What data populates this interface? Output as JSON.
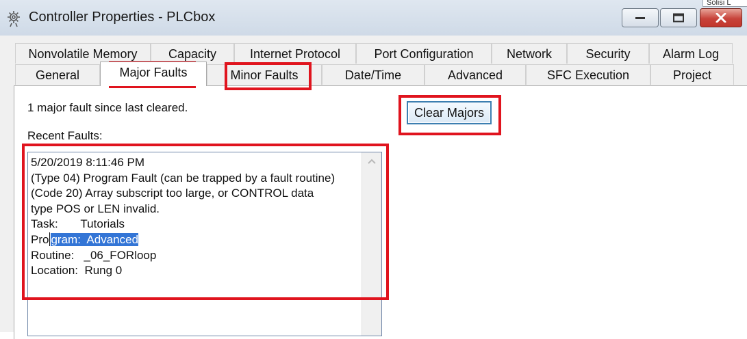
{
  "window": {
    "title": "Controller Properties - PLCbox",
    "icon": "gear-icon",
    "partial_label": "Solisi L"
  },
  "tabs_row1": [
    "Nonvolatile Memory",
    "Capacity",
    "Internet Protocol",
    "Port Configuration",
    "Network",
    "Security",
    "Alarm Log"
  ],
  "tabs_row2": [
    "General",
    "Major Faults",
    "Minor Faults",
    "Date/Time",
    "Advanced",
    "SFC Execution",
    "Project"
  ],
  "active_tab": "Major Faults",
  "major_faults": {
    "summary": "1 major fault since last cleared.",
    "recent_label": "Recent Faults:",
    "clear_button": "Clear Majors",
    "fault_lines": [
      "5/20/2019 8:11:46 PM",
      "(Type 04) Program Fault (can be trapped by a fault routine)",
      "(Code 20) Array subscript too large, or CONTROL data",
      "type POS or LEN invalid.",
      "Task:       Tutorials"
    ],
    "program_prefix": "Pro",
    "program_selected": "gram:  Advanced",
    "fault_lines_after": [
      "Routine:   _06_FORloop",
      "Location:  Rung 0"
    ]
  },
  "colors": {
    "highlight": "#e0141e",
    "selection": "#3375d6",
    "close_button": "#c7433a"
  }
}
